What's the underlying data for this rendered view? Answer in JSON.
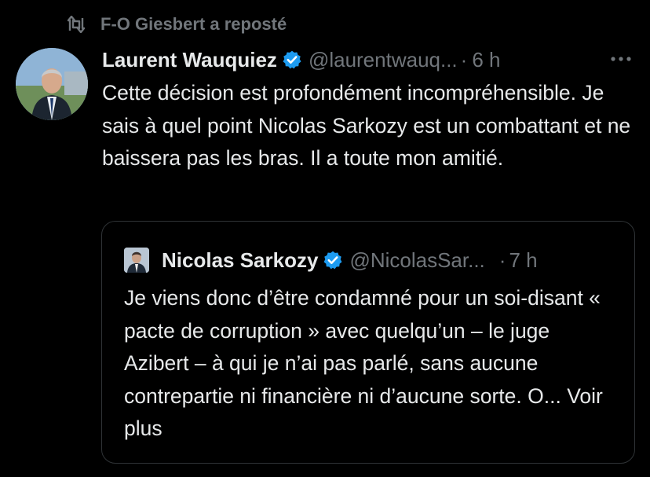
{
  "repost": {
    "icon": "repost-icon",
    "label": "F-O Giesbert a reposté"
  },
  "tweet": {
    "avatar_icon": "avatar",
    "author_name": "Laurent Wauquiez",
    "verified_icon": "verified-badge-icon",
    "handle": "@laurentwauq...",
    "separator": "·",
    "time": "6 h",
    "more_icon": "more-options-icon",
    "text": "Cette décision est profondément incompréhensible. Je sais à quel point Nicolas Sarkozy est un combattant et ne baissera pas les bras. Il a toute mon amitié."
  },
  "quote": {
    "avatar_icon": "avatar",
    "author_name": "Nicolas Sarkozy",
    "verified_icon": "verified-badge-icon",
    "handle": "@NicolasSar...",
    "separator": "·",
    "time": "7 h",
    "text": "Je viens donc d’être condamné pour un soi-disant « pacte de corruption » avec quelqu’un – le juge Azibert – à qui je n’ai pas parlé, sans aucune contrepartie ni financière ni d’aucune sorte. O...",
    "see_more": "Voir plus"
  },
  "colors": {
    "background": "#000000",
    "text": "#e7e9ea",
    "secondary": "#71767b",
    "border": "#2f3336",
    "verified": "#1d9bf0"
  }
}
